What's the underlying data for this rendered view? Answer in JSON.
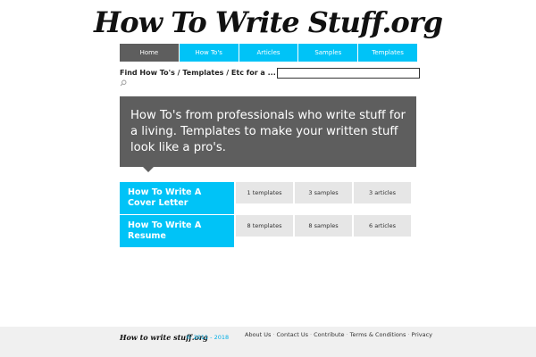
{
  "site": {
    "logo_text": "How To Write Stuff.org"
  },
  "nav": {
    "items": [
      {
        "label": "Home",
        "active": true
      },
      {
        "label": "How To's",
        "active": false
      },
      {
        "label": "Articles",
        "active": false
      },
      {
        "label": "Samples",
        "active": false
      },
      {
        "label": "Templates",
        "active": false
      }
    ]
  },
  "search": {
    "label": "Find How To's / Templates / Etc for a ...",
    "value": "",
    "icon": "search-icon"
  },
  "hero": {
    "text": "How To's from professionals who write stuff for a living. Templates to make your written stuff look like a pro's."
  },
  "topics": [
    {
      "title": "How To Write A Cover Letter",
      "templates": "1 templates",
      "samples": "3 samples",
      "articles": "3 articles"
    },
    {
      "title": "How To Write A Resume",
      "templates": "8 templates",
      "samples": "8 samples",
      "articles": "6 articles"
    }
  ],
  "footer": {
    "logo_text": "How to write stuff.org",
    "copyright": "© 2011 - 2018",
    "links": [
      "About Us",
      "Contact Us",
      "Contribute",
      "Terms & Conditions",
      "Privacy"
    ],
    "separator": "·"
  },
  "colors": {
    "accent": "#00c3f7",
    "dark": "#5e5e5e",
    "stat_bg": "#e6e6e6",
    "footer_bg": "#f0f0f0"
  }
}
